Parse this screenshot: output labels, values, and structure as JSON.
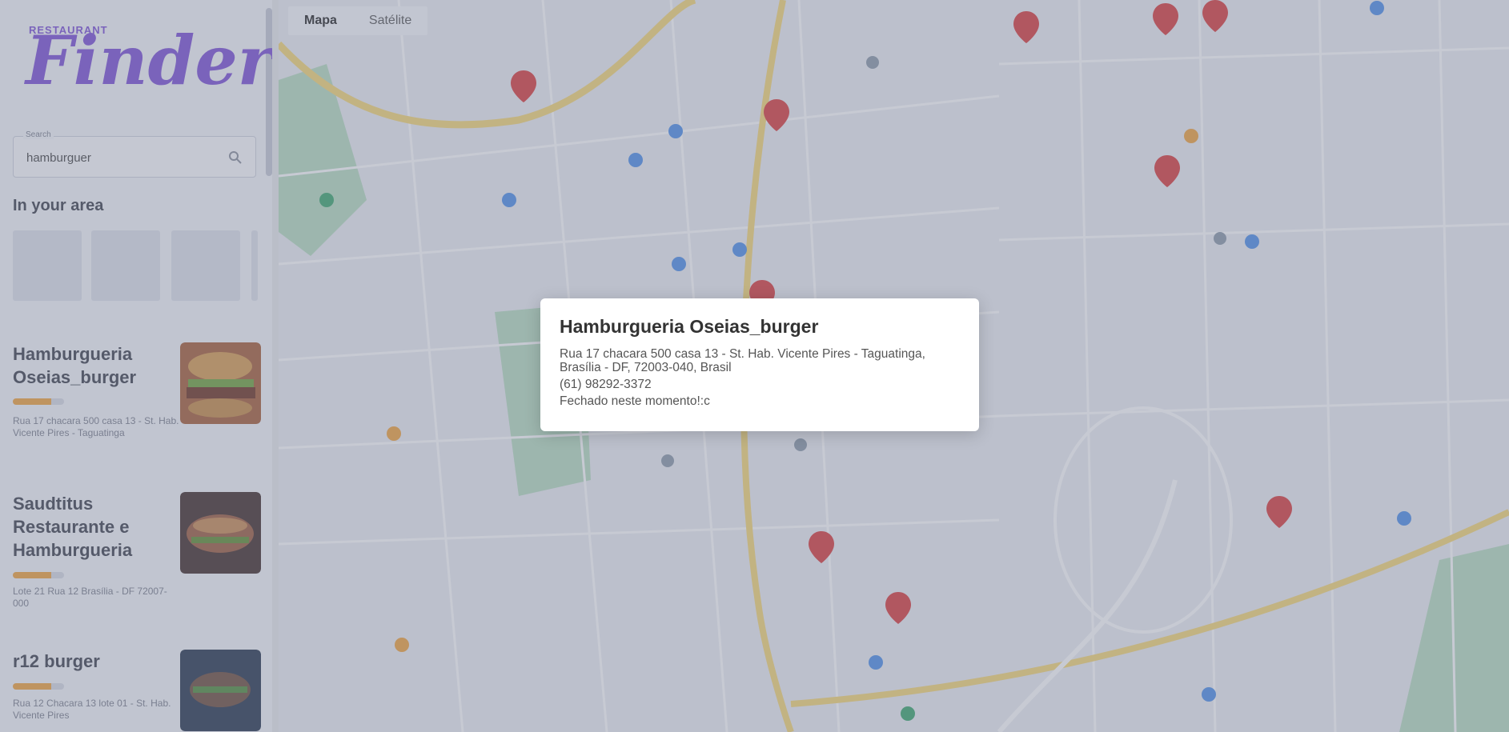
{
  "brand": {
    "small": "RESTAURANT",
    "big": "Finder"
  },
  "search": {
    "label": "Search",
    "value": "hamburguer"
  },
  "section_title": "In your area",
  "map_tabs": [
    {
      "label": "Mapa"
    },
    {
      "label": "Satélite"
    }
  ],
  "results": [
    {
      "name": "Hamburgueria Oseias_burger",
      "address": "Rua 17 chacara 500 casa 13 - St. Hab. Vicente Pires - Taguatinga",
      "rating": 4
    },
    {
      "name": "Saudtitus Restaurante e Hamburgueria",
      "address": "Lote 21 Rua 12 Brasília - DF 72007-000",
      "rating": 4
    },
    {
      "name": "r12 burger",
      "address": "Rua 12 Chacara 13 lote 01 - St. Hab. Vicente Pires",
      "rating": 4
    }
  ],
  "modal": {
    "title": "Hamburgueria Oseias_burger",
    "address_line1": "Rua 17 chacara 500 casa 13 - St. Hab. Vicente Pires - Taguatinga,",
    "address_line2": "Brasília - DF, 72003-040, Brasil",
    "phone": "(61) 98292-3372",
    "status": "Fechado neste momento!:c"
  },
  "colors": {
    "brand_purple": "#7b4fd6",
    "pin_red": "#d93a3a",
    "pin_blue": "#4c8ee8",
    "pin_orange": "#f2a23a",
    "road_yellow": "#f7d774",
    "park_green": "#b7dcc0"
  }
}
